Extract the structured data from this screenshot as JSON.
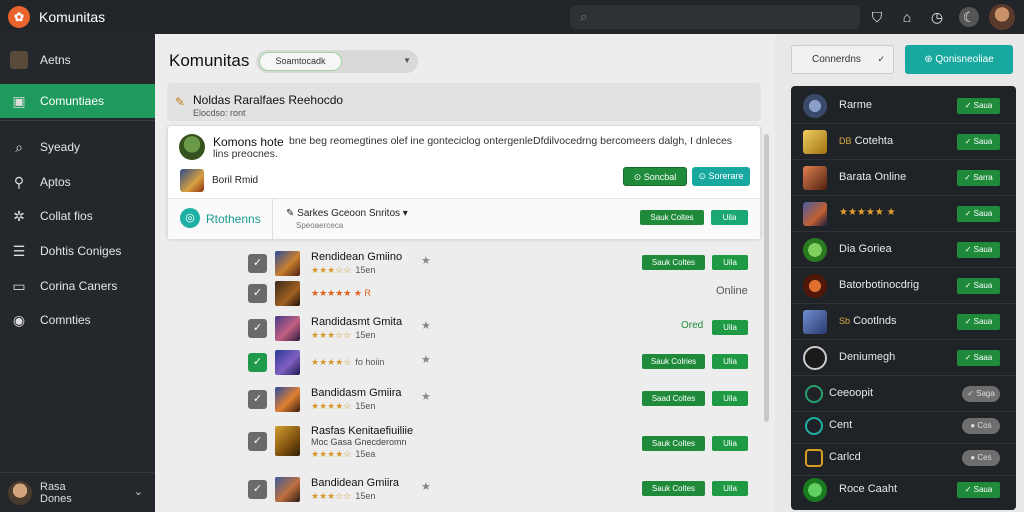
{
  "app": {
    "title": "Komunitas"
  },
  "topbar": {
    "icons": [
      "search-icon",
      "bookmark-icon",
      "home-icon",
      "clock-icon",
      "moon-icon"
    ]
  },
  "sidebar": {
    "items": [
      {
        "label": "Aetns",
        "icon": "avatar-icon"
      },
      {
        "label": "Comuntiaes",
        "icon": "community-icon",
        "active": true
      },
      {
        "label": "Syeady",
        "icon": "search-icon"
      },
      {
        "label": "Aptos",
        "icon": "user-icon"
      },
      {
        "label": "Collat fios",
        "icon": "gear-icon"
      },
      {
        "label": "Dohtis Coniges",
        "icon": "list-icon"
      },
      {
        "label": "Corina Caners",
        "icon": "card-icon"
      },
      {
        "label": "Comnties",
        "icon": "globe-icon"
      }
    ],
    "user": {
      "line1": "Rasa",
      "line2": "Dones"
    }
  },
  "main": {
    "title": "Komunitas",
    "filter": "Soamtocadk",
    "notice": {
      "title": "Noldas Raralfaes Reehocdo",
      "subtitle": "Elocdso: ront"
    },
    "card": {
      "name": "Komons hote",
      "description": "bne beg reomegtines olef ine gonteciclog ontergenleDfdilvocedrng bercomeers dalgh, I dnleces lins preocnes.",
      "sub": "Boril Rmid",
      "btn_primary": "Soncbal",
      "btn_secondary": "Sorerare",
      "footer_label": "Rtothenns",
      "footer_title": "Sarkes Gceoon Snritos",
      "footer_sub": "Speoaerceca"
    },
    "rows": [
      {
        "title": "Rendidean Gmiino",
        "stars": "★★★☆☆",
        "count": "15en",
        "status": "",
        "btn1": "Sauk Coltes",
        "btn2": "Uila",
        "checked": false
      },
      {
        "title": "",
        "stars": "★★★★★ ★ R",
        "count": "",
        "status": "Online",
        "btn1": "",
        "btn2": "",
        "checked": false
      },
      {
        "title": "Randidasmt Gmita",
        "stars": "★★★☆☆",
        "count": "15en",
        "status": "Ored",
        "btn1": "",
        "btn2": "Uila",
        "checked": false
      },
      {
        "title": "",
        "stars": "★★★★☆",
        "count": "fo hoiin",
        "status": "",
        "btn1": "Sauk Colries",
        "btn2": "Ulia",
        "checked": true
      },
      {
        "title": "Bandidasm Gmiira",
        "stars": "★★★★☆",
        "count": "15en",
        "status": "",
        "btn1": "Saad Coltes",
        "btn2": "Uila",
        "checked": false
      },
      {
        "title": "Rasfas Kenitaefiuiliie",
        "stars": "★★★★☆",
        "count": "15ea",
        "status": "",
        "btn1": "Sauk Coltes",
        "btn2": "Ulia",
        "checked": false,
        "subtitle": "Moc Gasa Gnecderomn"
      },
      {
        "title": "Bandidean Gmiira",
        "stars": "★★★☆☆",
        "count": "15en",
        "status": "",
        "btn1": "Sauk Coltes",
        "btn2": "Uila",
        "checked": false
      }
    ]
  },
  "right": {
    "connect_label": "Connerdns",
    "cta_label": "Qonisneoliae",
    "items": [
      {
        "label": "Rarme",
        "btn": "Saua",
        "color": "#5a6a8a"
      },
      {
        "label": "Cotehta",
        "btn": "Saua",
        "color": "#d8b040",
        "prefix": "DB"
      },
      {
        "label": "Barata Online",
        "btn": "Sarra",
        "color": "#c06040"
      },
      {
        "label": "★★★★★ ★",
        "btn": "Saua",
        "color": "#3a4a8a"
      },
      {
        "label": "Dia Goriea",
        "btn": "Saua",
        "color": "#3aa03a"
      },
      {
        "label": "Batorbotinocdrig",
        "btn": "Saua",
        "color": "#a04020"
      },
      {
        "label": "Cootlnds",
        "btn": "Saua",
        "color": "#4a6aa0",
        "prefix": "Sb"
      },
      {
        "label": "Deniumegh",
        "btn": "Saaa",
        "color": "#333333"
      },
      {
        "label": "Ceeoopit",
        "btn": "Saga",
        "color": "#2aa070",
        "gray": true
      },
      {
        "label": "Cent",
        "btn": "Cos",
        "color": "#1fb0a5",
        "gray": true
      },
      {
        "label": "Carlcd",
        "btn": "Ces",
        "color": "#d8a020",
        "gray": true
      },
      {
        "label": "Roce Caaht",
        "btn": "Saua",
        "color": "#2aa040"
      }
    ]
  }
}
